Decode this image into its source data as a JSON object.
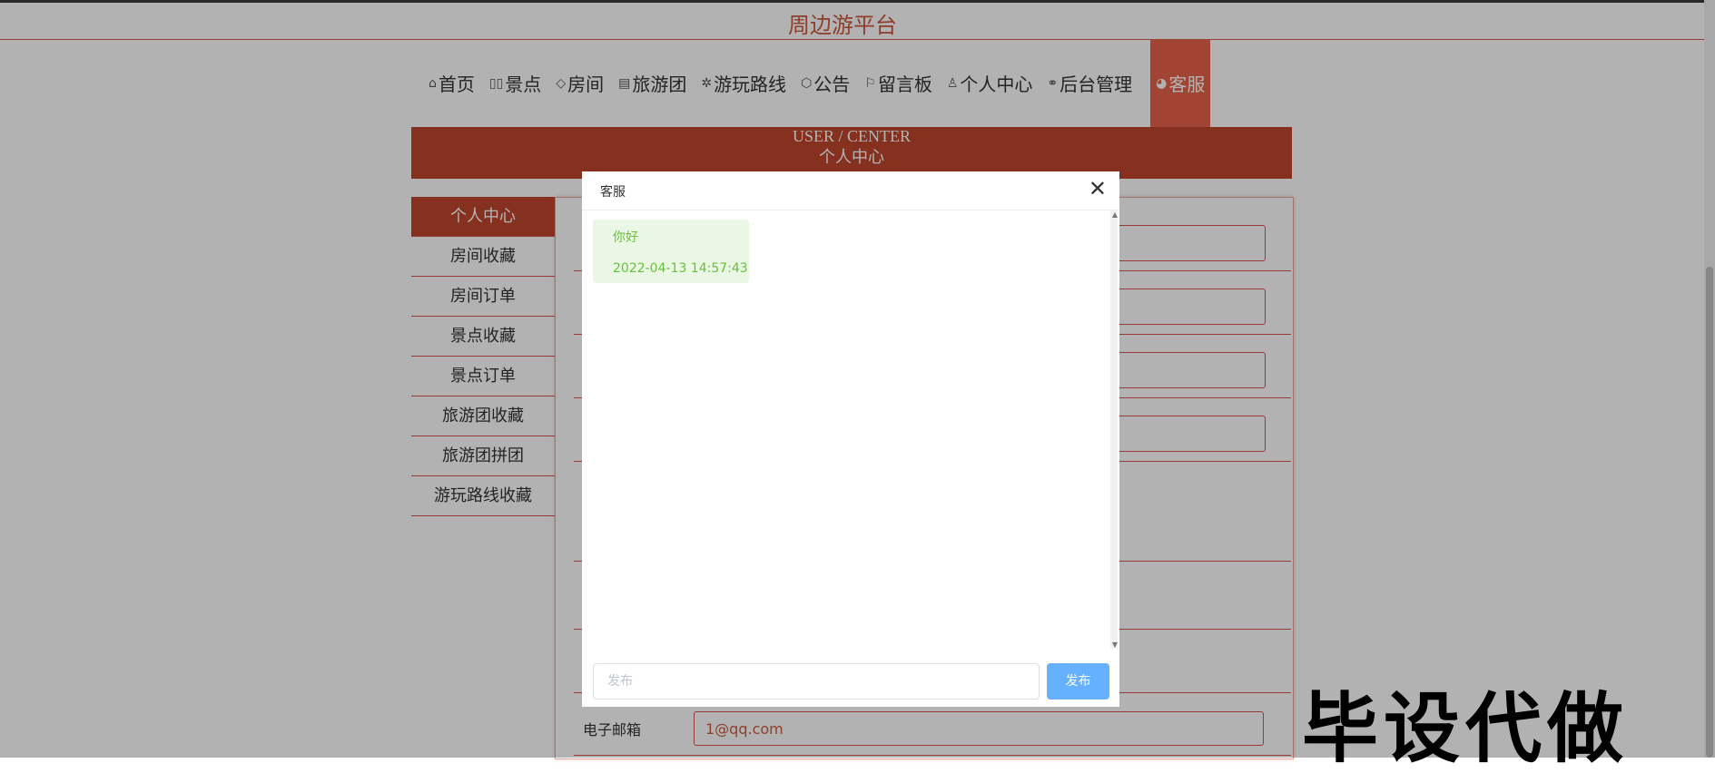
{
  "site": {
    "title": "周边游平台"
  },
  "nav": {
    "items": [
      {
        "icon": "home-icon",
        "glyph": "⌂",
        "label": "首页"
      },
      {
        "icon": "scenic-icon",
        "glyph": "▯▯",
        "label": "景点"
      },
      {
        "icon": "tag-icon",
        "glyph": "◇",
        "label": "房间"
      },
      {
        "icon": "calendar-icon",
        "glyph": "▤",
        "label": "旅游团"
      },
      {
        "icon": "gear-icon",
        "glyph": "✲",
        "label": "游玩路线"
      },
      {
        "icon": "box-icon",
        "glyph": "⬡",
        "label": "公告"
      },
      {
        "icon": "flag-icon",
        "glyph": "⚐",
        "label": "留言板"
      },
      {
        "icon": "user-icon",
        "glyph": "♙",
        "label": "个人中心"
      },
      {
        "icon": "link-icon",
        "glyph": "⚭",
        "label": "后台管理"
      },
      {
        "icon": "chat-icon",
        "glyph": "◕",
        "label": "客服"
      }
    ]
  },
  "banner": {
    "en": "USER / CENTER",
    "cn": "个人中心"
  },
  "sidebar": {
    "items": [
      "个人中心",
      "房间收藏",
      "房间订单",
      "景点收藏",
      "景点订单",
      "旅游团收藏",
      "旅游团拼团",
      "游玩路线收藏"
    ]
  },
  "form": {
    "email_label": "电子邮箱",
    "email_value": "1@qq.com"
  },
  "modal": {
    "title": "客服",
    "close_glyph": "✕",
    "messages": [
      {
        "text": "你好",
        "time": "2022-04-13 14:57:43"
      }
    ],
    "input_placeholder": "发布",
    "send_label": "发布"
  },
  "watermark": "毕设代做",
  "colors": {
    "brand": "#c0462d",
    "accent": "#e8624a",
    "bubble_text": "#67c23a",
    "send_button": "#66b1ff"
  }
}
